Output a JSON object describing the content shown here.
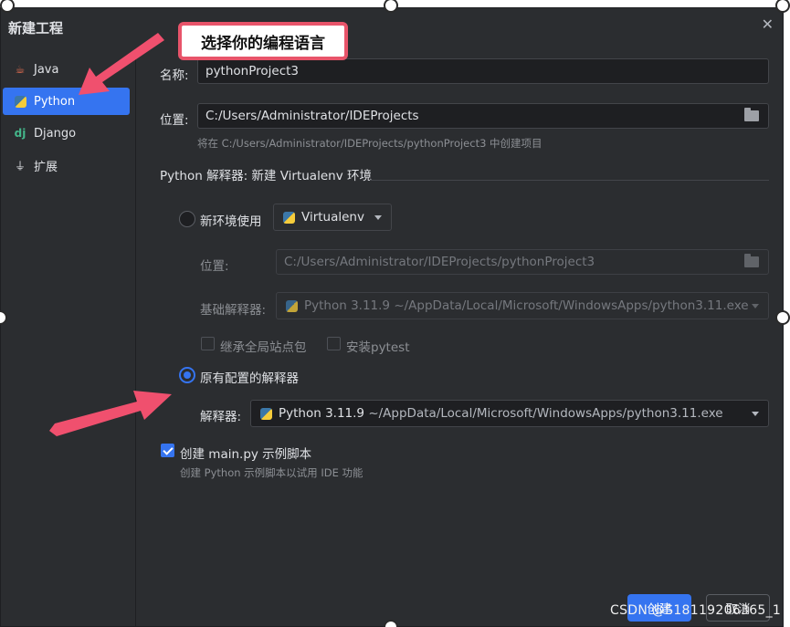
{
  "dialog": {
    "title": "新建工程",
    "close_glyph": "✕"
  },
  "sidebar": {
    "items": [
      {
        "label": "Java",
        "icon": "java-cup-icon",
        "glyph": "☕"
      },
      {
        "label": "Python",
        "icon": "python-icon",
        "glyph": ""
      },
      {
        "label": "Django",
        "icon": "django-icon",
        "glyph": "dj"
      },
      {
        "label": "扩展",
        "icon": "plug-icon",
        "glyph": "⏚"
      }
    ],
    "selected": "Python"
  },
  "annotation": {
    "callout_text": "选择你的编程语言",
    "arrow_color": "#f0506e"
  },
  "form": {
    "name_label": "名称:",
    "name_value": "pythonProject3",
    "location_label": "位置:",
    "location_value": "C:/Users/Administrator/IDEProjects",
    "location_hint": "将在 C:/Users/Administrator/IDEProjects/pythonProject3 中创建项目",
    "interpreter_section": "Python 解释器: 新建 Virtualenv 环境",
    "new_env": {
      "label": "新环境使用",
      "env_type": "Virtualenv",
      "location_label": "位置:",
      "location_value": "C:/Users/Administrator/IDEProjects/pythonProject3",
      "base_label": "基础解释器:",
      "base_value": "Python 3.11.9 ~/AppData/Local/Microsoft/WindowsApps/python3.11.exe",
      "inherit_label": "继承全局站点包",
      "pytest_label": "安装pytest"
    },
    "existing": {
      "label": "原有配置的解释器",
      "interpreter_label": "解释器:",
      "interpreter_version": "Python 3.11.9",
      "interpreter_path": " ~/AppData/Local/Microsoft/WindowsApps/python3.11.exe"
    },
    "create_main": {
      "label": "创建 main.py 示例脚本",
      "hint": "创建 Python 示例脚本以试用 IDE 功能",
      "checked": true
    }
  },
  "buttons": {
    "create": "创建",
    "cancel": "取消"
  },
  "watermark": "CSDN @S18119206365_1",
  "colors": {
    "accent": "#3574f0",
    "bg": "#2b2d30",
    "callout_border": "#e8546a"
  }
}
